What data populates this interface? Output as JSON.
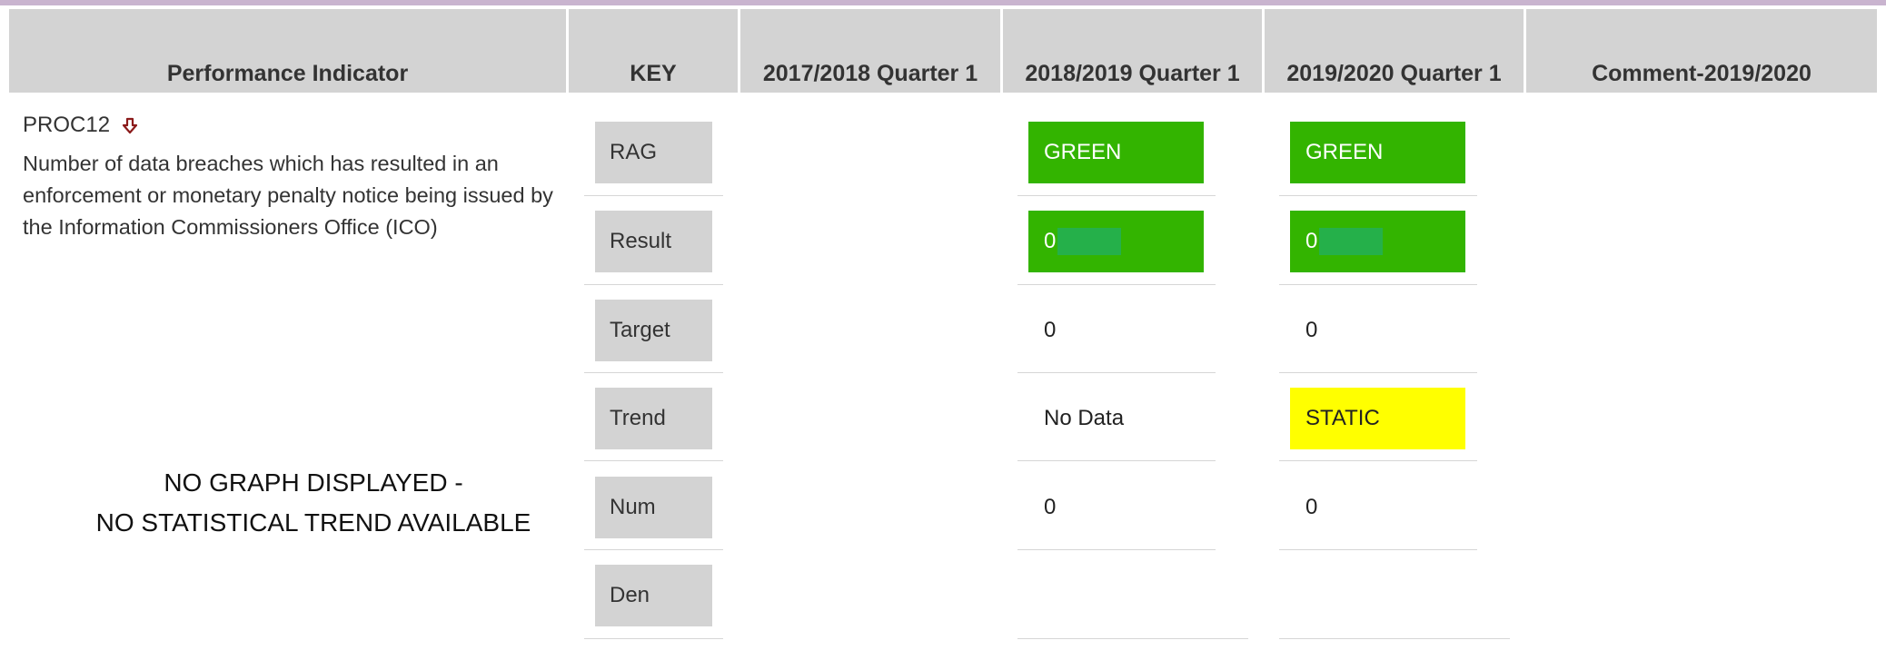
{
  "headers": {
    "indicator": "Performance Indicator",
    "key": "KEY",
    "q2017": "2017/2018 Quarter 1",
    "q2018": "2018/2019 Quarter 1",
    "q2019": "2019/2020 Quarter 1",
    "comment": "Comment-2019/2020"
  },
  "indicator": {
    "code": "PROC12",
    "trend_icon": "arrow-down-icon",
    "description": "Number of data breaches which has resulted in an enforcement or monetary penalty notice being issued by the Information Commissioners Office (ICO)",
    "no_graph_line1": "NO GRAPH DISPLAYED -",
    "no_graph_line2": "NO STATISTICAL TREND AVAILABLE"
  },
  "keys": [
    "RAG",
    "Result",
    "Target",
    "Trend",
    "Num",
    "Den"
  ],
  "values": {
    "q2018": {
      "rag": "GREEN",
      "result": "0",
      "target": "0",
      "trend": "No Data",
      "num": "0",
      "den": ""
    },
    "q2019": {
      "rag": "GREEN",
      "result": "0",
      "target": "0",
      "trend": "STATIC",
      "num": "0",
      "den": ""
    }
  },
  "colors": {
    "green": "#33b400",
    "yellow": "#ffff00",
    "arrow": "#8b1a1a",
    "header": "#d3d3d3"
  }
}
